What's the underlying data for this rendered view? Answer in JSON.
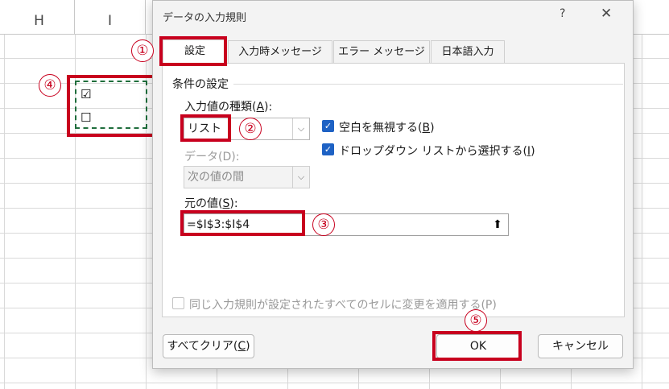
{
  "sheet": {
    "columns": [
      "H",
      "I"
    ],
    "cells": [
      "☑",
      "☐"
    ]
  },
  "dialog": {
    "title": "データの入力規則",
    "help": "?",
    "close": "✕",
    "tabs": [
      "設定",
      "入力時メッセージ",
      "エラー メッセージ",
      "日本語入力"
    ],
    "group_label": "条件の設定",
    "allow_label_pre": "入力値の種類(",
    "allow_key": "A",
    "allow_label_post": "):",
    "allow_value": "リスト",
    "data_label": "データ(D):",
    "data_value": "次の値の間",
    "ignore_blank_pre": "空白を無視する(",
    "ignore_blank_key": "B",
    "ignore_blank_post": ")",
    "dropdown_pre": "ドロップダウン リストから選択する(",
    "dropdown_key": "I",
    "dropdown_post": ")",
    "source_label_pre": "元の値(",
    "source_key": "S",
    "source_label_post": "):",
    "source_value": "=$I$3:$I$4",
    "apply_all": "同じ入力規則が設定されたすべてのセルに変更を適用する(P)",
    "clear_pre": "すべてクリア(",
    "clear_key": "C",
    "clear_post": ")",
    "ok": "OK",
    "cancel": "キャンセル"
  },
  "annotations": [
    "①",
    "②",
    "③",
    "④",
    "⑤"
  ],
  "colors": {
    "highlight": "#c8001e",
    "checkbox": "#1e62c4",
    "copy_border": "#1f6e3c"
  }
}
